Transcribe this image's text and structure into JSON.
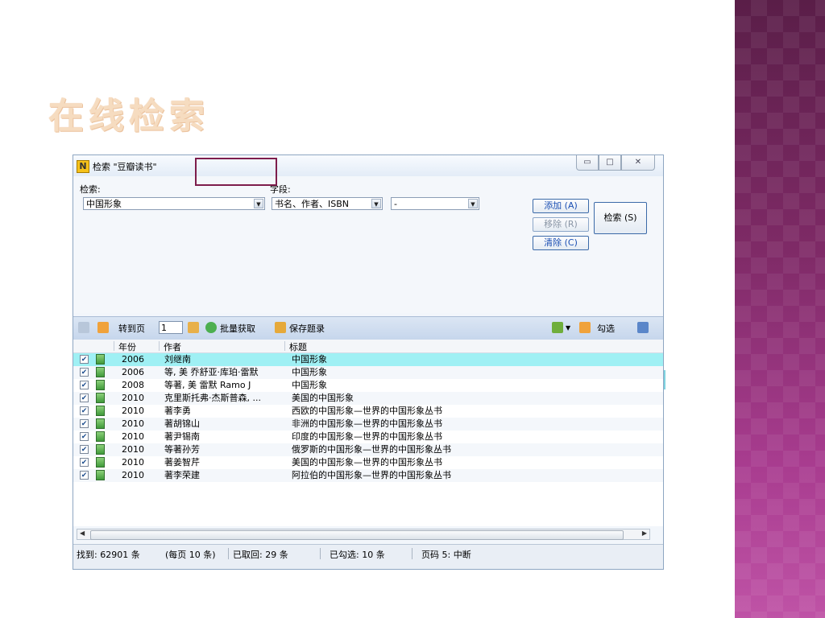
{
  "slide_title": "在线检索",
  "window": {
    "icon_letter": "N",
    "title": "检索 \"豆瓣读书\"",
    "controls": {
      "minimize": "▭",
      "maximize": "□",
      "close": "✕"
    }
  },
  "form": {
    "search_label": "检索:",
    "search_value": "中国形象",
    "field_label": "字段:",
    "field_value": "书名、作者、ISBN",
    "operator_value": "-",
    "add_button": "添加 (A)",
    "remove_button": "移除 (R)",
    "clear_button": "清除 (C)",
    "search_button": "检索 (S)"
  },
  "toolbar": {
    "goto_page": "转到页",
    "page_value": "1",
    "batch_fetch": "批量获取",
    "save_record": "保存题录",
    "check": "勾选"
  },
  "table": {
    "columns": [
      "年份",
      "作者",
      "标题"
    ],
    "rows": [
      {
        "year": "2006",
        "author": "刘继南",
        "title": "中国形象"
      },
      {
        "year": "2006",
        "author": "等, 美 乔舒亚·库珀·雷默",
        "title": "中国形象"
      },
      {
        "year": "2008",
        "author": "等著, 美 雷默 Ramo J",
        "title": "中国形象"
      },
      {
        "year": "2010",
        "author": "克里斯托弗·杰斯普森, ...",
        "title": "美国的中国形象"
      },
      {
        "year": "2010",
        "author": "著李勇",
        "title": "西欧的中国形象—世界的中国形象丛书"
      },
      {
        "year": "2010",
        "author": "著胡锦山",
        "title": "非洲的中国形象—世界的中国形象丛书"
      },
      {
        "year": "2010",
        "author": "著尹锡南",
        "title": "印度的中国形象—世界的中国形象丛书"
      },
      {
        "year": "2010",
        "author": "等著孙芳",
        "title": "俄罗斯的中国形象—世界的中国形象丛书"
      },
      {
        "year": "2010",
        "author": "著姜智芹",
        "title": "美国的中国形象—世界的中国形象丛书"
      },
      {
        "year": "2010",
        "author": "著李荣建",
        "title": "阿拉伯的中国形象—世界的中国形象丛书"
      }
    ],
    "selected_row": 0
  },
  "status": {
    "found": "找到: 62901 条",
    "per_page": "(每页 10 条)",
    "fetched": "已取回: 29 条",
    "checked": "已勾选: 10 条",
    "page": "页码 5: 中断"
  },
  "colors": {
    "accent": "#7d1d4c",
    "selection": "#9ff0f4",
    "title": "#f6dcc0"
  }
}
